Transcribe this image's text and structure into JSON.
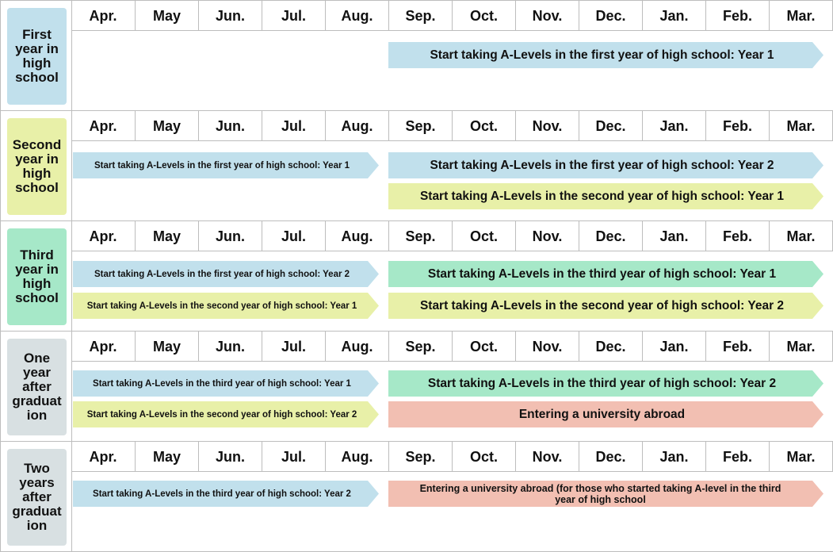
{
  "months": [
    "Apr.",
    "May",
    "Jun.",
    "Jul.",
    "Aug.",
    "Sep.",
    "Oct.",
    "Nov.",
    "Dec.",
    "Jan.",
    "Feb.",
    "Mar."
  ],
  "colors": {
    "blue": "#c1e0ec",
    "yellow": "#e8f0a8",
    "mint": "#a6e8c8",
    "salmon": "#f2bfb2",
    "gray": "#d8e0e2"
  },
  "sections": [
    {
      "label": "First year in high school",
      "bars": [
        "Start taking A-Levels in the first year of high school: Year 1"
      ]
    },
    {
      "label": "Second year in high school",
      "bars": [
        "Start taking A-Levels in the first year of high school: Year 1",
        "Start taking A-Levels in the first year of high school: Year 2",
        "Start taking A-Levels in the second year of high school: Year 1"
      ]
    },
    {
      "label": "Third year in high school",
      "bars": [
        "Start taking A-Levels in the first year of high school: Year 2",
        "Start taking A-Levels in the third year of high school: Year 1",
        "Start taking A-Levels in the second year of high school: Year 1",
        "Start taking A-Levels in the second year of high school: Year 2"
      ]
    },
    {
      "label": "One year after graduat ion",
      "bars": [
        "Start taking A-Levels in the third year of high school: Year 1",
        "Start taking A-Levels in the third year of high school: Year 2",
        "Start taking A-Levels in the second year of high school: Year 2",
        "Entering a university abroad"
      ]
    },
    {
      "label": "Two years after graduat ion",
      "bars": [
        "Start taking A-Levels in the third year of high school: Year 2",
        "Entering a university abroad (for those who started taking A-level in the third year of high school"
      ]
    }
  ]
}
